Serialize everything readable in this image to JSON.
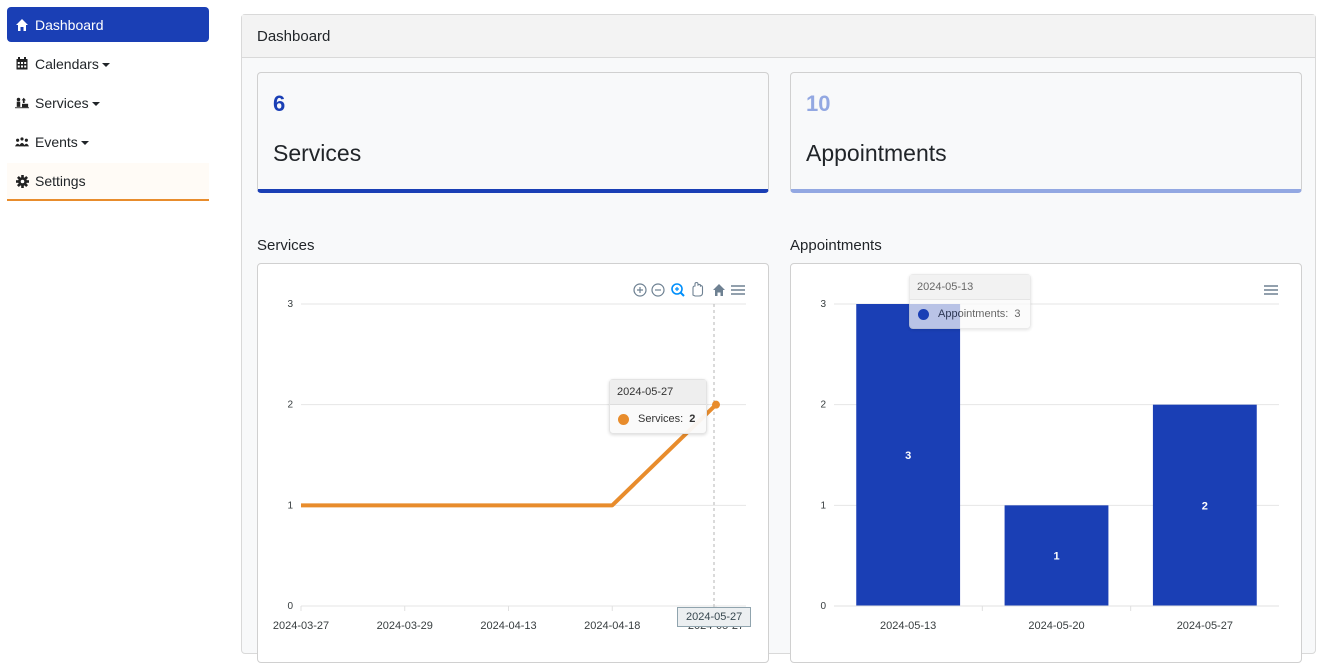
{
  "sidebar": {
    "items": [
      {
        "label": "Dashboard",
        "icon": "home-icon"
      },
      {
        "label": "Calendars",
        "icon": "calendar-icon"
      },
      {
        "label": "Services",
        "icon": "services-icon"
      },
      {
        "label": "Events",
        "icon": "events-icon"
      },
      {
        "label": "Settings",
        "icon": "gear-icon"
      }
    ]
  },
  "main": {
    "title": "Dashboard"
  },
  "stats": [
    {
      "value": "6",
      "label": "Services"
    },
    {
      "value": "10",
      "label": "Appointments"
    }
  ],
  "colors": {
    "primary": "#1a3fb5",
    "light": "#93a8e2",
    "accent": "#e88c2c"
  },
  "charts": {
    "services_title": "Services",
    "appointments_title": "Appointments",
    "services_tooltip": {
      "title": "2024-05-27",
      "series": "Services:",
      "value": "2"
    },
    "services_xtip": "2024-05-27",
    "appointments_tooltip": {
      "title": "2024-05-13",
      "series": "Appointments:",
      "value": "3"
    }
  },
  "chart_data": [
    {
      "type": "line",
      "title": "Services",
      "x": [
        "2024-03-27",
        "2024-03-29",
        "2024-04-13",
        "2024-04-18",
        "2024-05-27"
      ],
      "series": [
        {
          "name": "Services",
          "values": [
            1,
            1,
            1,
            1,
            2
          ]
        }
      ],
      "ylim": [
        0,
        3
      ],
      "yticks": [
        0,
        1,
        2,
        3
      ],
      "grid": true
    },
    {
      "type": "bar",
      "title": "Appointments",
      "categories": [
        "2024-05-13",
        "2024-05-20",
        "2024-05-27"
      ],
      "series": [
        {
          "name": "Appointments",
          "values": [
            3,
            1,
            2
          ]
        }
      ],
      "ylim": [
        0,
        3
      ],
      "yticks": [
        0,
        1,
        2,
        3
      ],
      "grid": true
    }
  ]
}
